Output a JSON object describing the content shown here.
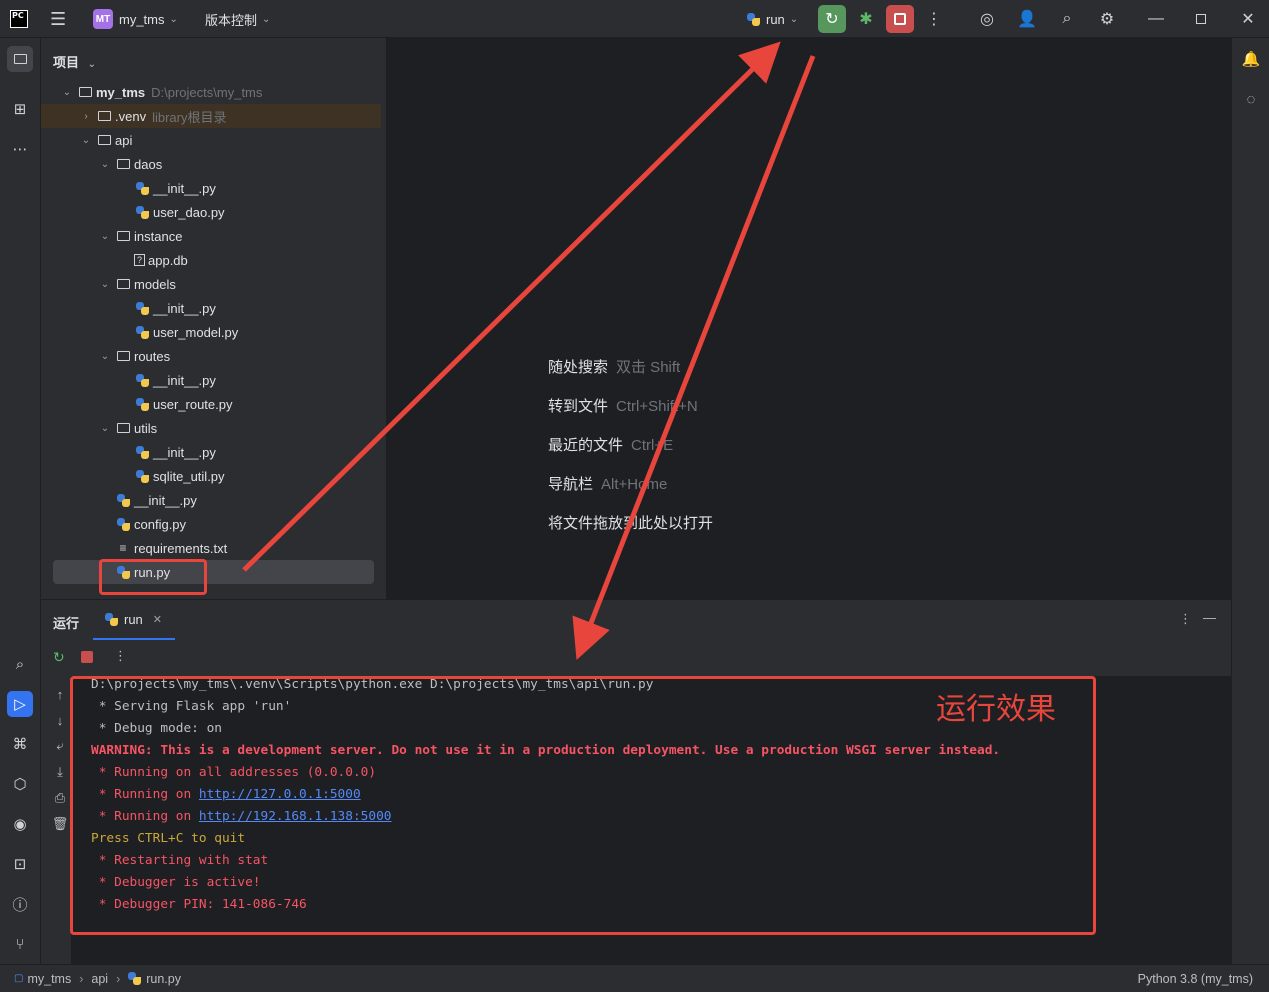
{
  "titlebar": {
    "logo": "PC",
    "project_badge": "MT",
    "project_name": "my_tms",
    "vcs_label": "版本控制",
    "run_config": "run"
  },
  "project_panel": {
    "header": "项目",
    "tree": [
      {
        "label": "my_tms",
        "hint": "D:\\projects\\my_tms",
        "icon": "folder-icon",
        "expanded": true,
        "level": 0
      },
      {
        "label": ".venv",
        "hint": "library根目录",
        "icon": "folder-icon",
        "expanded": false,
        "level": 1
      },
      {
        "label": "api",
        "hint": "",
        "icon": "package-icon",
        "expanded": true,
        "level": 1
      },
      {
        "label": "daos",
        "hint": "",
        "icon": "package-icon",
        "expanded": true,
        "level": 2
      },
      {
        "label": "__init__.py",
        "hint": "",
        "icon": "python-file-icon",
        "level": 3
      },
      {
        "label": "user_dao.py",
        "hint": "",
        "icon": "python-file-icon",
        "level": 3
      },
      {
        "label": "instance",
        "hint": "",
        "icon": "folder-icon",
        "expanded": true,
        "level": 2
      },
      {
        "label": "app.db",
        "hint": "",
        "icon": "unknown-file-icon",
        "level": 3
      },
      {
        "label": "models",
        "hint": "",
        "icon": "package-icon",
        "expanded": true,
        "level": 2
      },
      {
        "label": "__init__.py",
        "hint": "",
        "icon": "python-file-icon",
        "level": 3
      },
      {
        "label": "user_model.py",
        "hint": "",
        "icon": "python-file-icon",
        "level": 3
      },
      {
        "label": "routes",
        "hint": "",
        "icon": "package-icon",
        "expanded": true,
        "level": 2
      },
      {
        "label": "__init__.py",
        "hint": "",
        "icon": "python-file-icon",
        "level": 3
      },
      {
        "label": "user_route.py",
        "hint": "",
        "icon": "python-file-icon",
        "level": 3
      },
      {
        "label": "utils",
        "hint": "",
        "icon": "package-icon",
        "expanded": true,
        "level": 2
      },
      {
        "label": "__init__.py",
        "hint": "",
        "icon": "python-file-icon",
        "level": 3
      },
      {
        "label": "sqlite_util.py",
        "hint": "",
        "icon": "python-file-icon",
        "level": 3
      },
      {
        "label": "__init__.py",
        "hint": "",
        "icon": "python-file-icon",
        "level": 2
      },
      {
        "label": "config.py",
        "hint": "",
        "icon": "python-file-icon",
        "level": 2
      },
      {
        "label": "requirements.txt",
        "hint": "",
        "icon": "text-file-icon",
        "level": 2
      },
      {
        "label": "run.py",
        "hint": "",
        "icon": "python-file-icon",
        "level": 2,
        "selected": true
      }
    ]
  },
  "editor_hints": [
    {
      "label": "随处搜索",
      "key": "双击 Shift"
    },
    {
      "label": "转到文件",
      "key": "Ctrl+Shift+N"
    },
    {
      "label": "最近的文件",
      "key": "Ctrl+E"
    },
    {
      "label": "导航栏",
      "key": "Alt+Home"
    },
    {
      "label": "将文件拖放到此处以打开",
      "key": ""
    }
  ],
  "run_panel": {
    "title": "运行",
    "tab": "run",
    "console": [
      {
        "text": "D:\\projects\\my_tms\\.venv\\Scripts\\python.exe D:\\projects\\my_tms\\api\\run.py",
        "style": "norm"
      },
      {
        "text": " * Serving Flask app 'run'",
        "style": "norm"
      },
      {
        "text": " * Debug mode: on",
        "style": "norm"
      },
      {
        "text": "WARNING: This is a development server. Do not use it in a production deployment. Use a production WSGI server instead.",
        "style": "red-bold"
      },
      {
        "text": " * Running on all addresses (0.0.0.0)",
        "style": "red"
      },
      {
        "text": " * Running on ",
        "link": "http://127.0.0.1:5000",
        "style": "red"
      },
      {
        "text": " * Running on ",
        "link": "http://192.168.1.138:5000",
        "style": "red"
      },
      {
        "text": "Press CTRL+C to quit",
        "style": "yellow"
      },
      {
        "text": " * Restarting with stat",
        "style": "red"
      },
      {
        "text": " * Debugger is active!",
        "style": "red"
      },
      {
        "text": " * Debugger PIN: 141-086-746",
        "style": "red"
      }
    ]
  },
  "annotation": {
    "label": "运行效果",
    "color": "#e8453c"
  },
  "statusbar": {
    "breadcrumb": [
      "my_tms",
      "api",
      "run.py"
    ],
    "interpreter": "Python 3.8 (my_tms)"
  }
}
